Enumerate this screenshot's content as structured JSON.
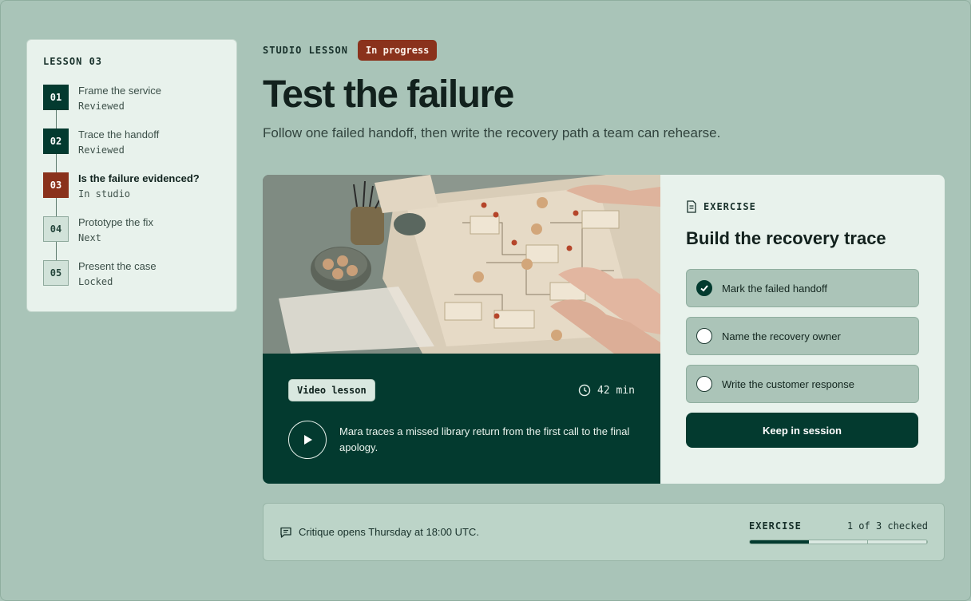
{
  "sidebar": {
    "lesson_label": "LESSON 03",
    "steps": [
      {
        "num": "01",
        "title": "Frame the service",
        "status": "Reviewed",
        "state": "done"
      },
      {
        "num": "02",
        "title": "Trace the handoff",
        "status": "Reviewed",
        "state": "done"
      },
      {
        "num": "03",
        "title": "Is the failure evidenced?",
        "status": "In studio",
        "state": "current"
      },
      {
        "num": "04",
        "title": "Prototype the fix",
        "status": "Next",
        "state": "pending"
      },
      {
        "num": "05",
        "title": "Present the case",
        "status": "Locked",
        "state": "pending"
      }
    ]
  },
  "header": {
    "kicker": "STUDIO LESSON",
    "badge": "In progress",
    "title": "Test the failure",
    "subtitle": "Follow one failed handoff, then write the recovery path a team can rehearse."
  },
  "video": {
    "chip": "Video lesson",
    "duration": "42 min",
    "description": "Mara traces a missed library return from the first call to the final apology."
  },
  "exercise": {
    "kicker": "EXERCISE",
    "title": "Build the recovery trace",
    "items": [
      {
        "label": "Mark the failed handoff",
        "checked": true
      },
      {
        "label": "Name the recovery owner",
        "checked": false
      },
      {
        "label": "Write the customer response",
        "checked": false
      }
    ],
    "button": "Keep in session"
  },
  "footer": {
    "critique": "Critique opens Thursday at 18:00 UTC.",
    "progress_label": "EXERCISE",
    "progress_text": "1 of 3 checked",
    "progress_done": 1,
    "progress_total": 3
  },
  "colors": {
    "background": "#a9c4b8",
    "dark_green": "#033a2f",
    "rust": "#8a321c",
    "panel": "#e8f2ec"
  }
}
